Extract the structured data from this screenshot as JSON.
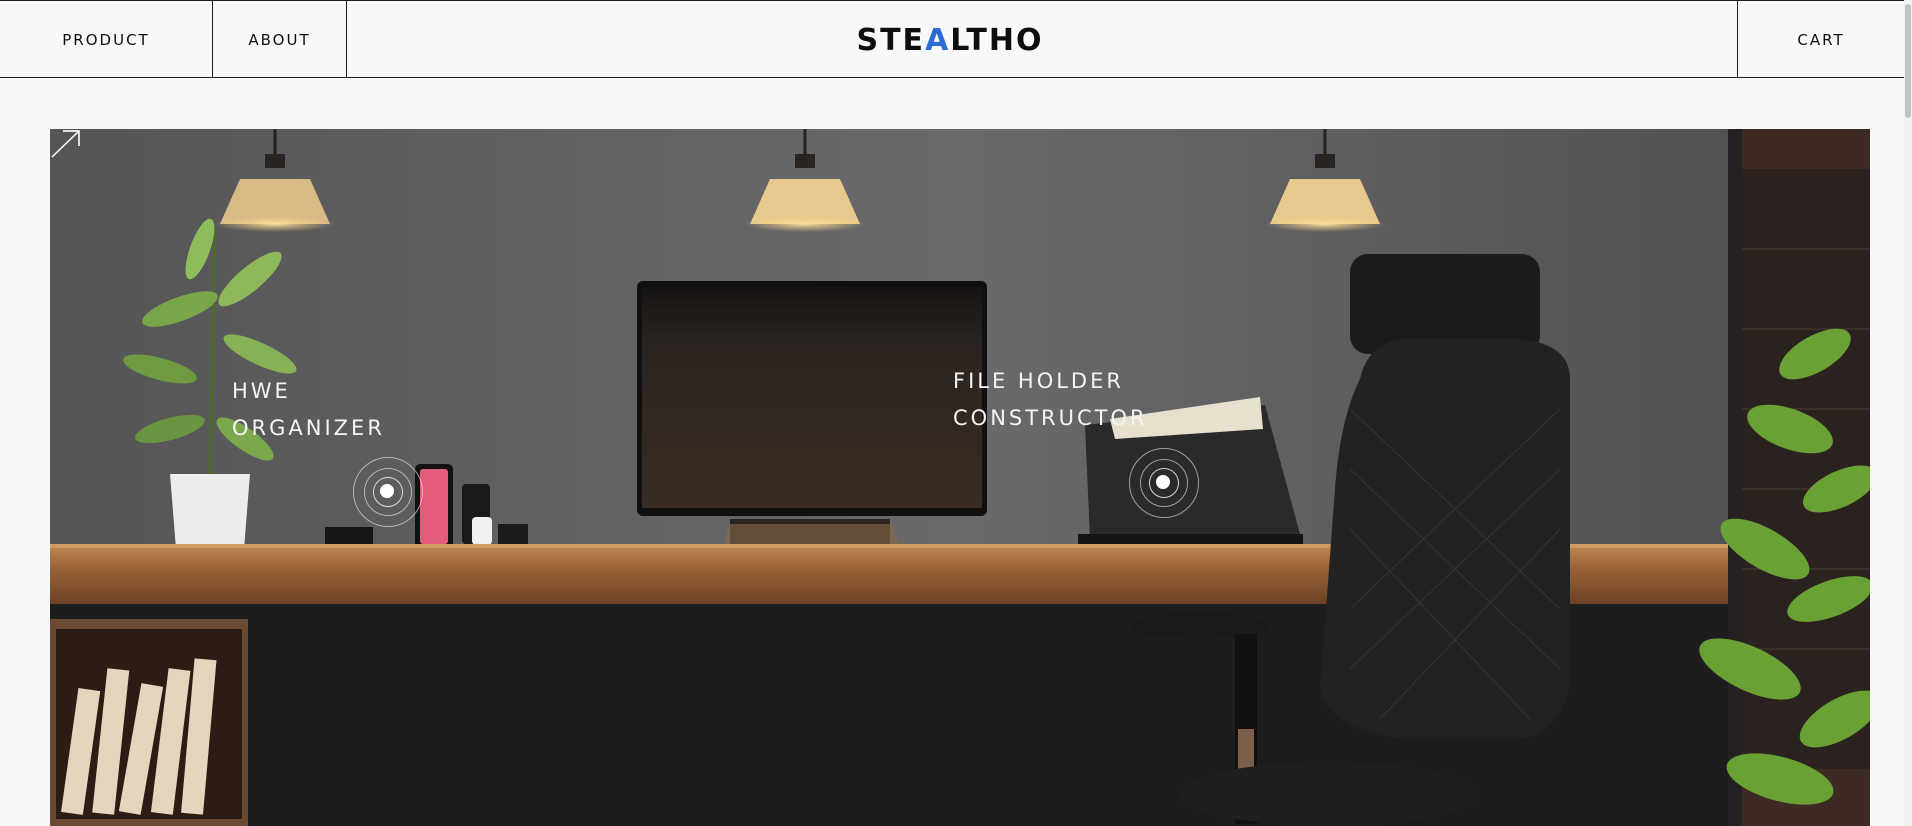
{
  "nav": {
    "left": [
      {
        "label": "PRODUCT"
      },
      {
        "label": "ABOUT"
      }
    ],
    "logo": {
      "part1": "STE",
      "part2": "A",
      "part3": "LTHO"
    },
    "cart_label": "CART"
  },
  "hero": {
    "hotspots": [
      {
        "line1": "HWE",
        "line2": "ORGANIZER",
        "icon": "arrow-up-right-icon"
      },
      {
        "line1": "FILE HOLDER",
        "line2": "CONSTRUCTOR",
        "icon": "arrow-up-right-icon"
      }
    ]
  },
  "colors": {
    "page_bg": "#f6f8fa",
    "text": "#111111",
    "logo_accent": "#2b6bd6",
    "hotspot_text": "#f4f4f4"
  }
}
